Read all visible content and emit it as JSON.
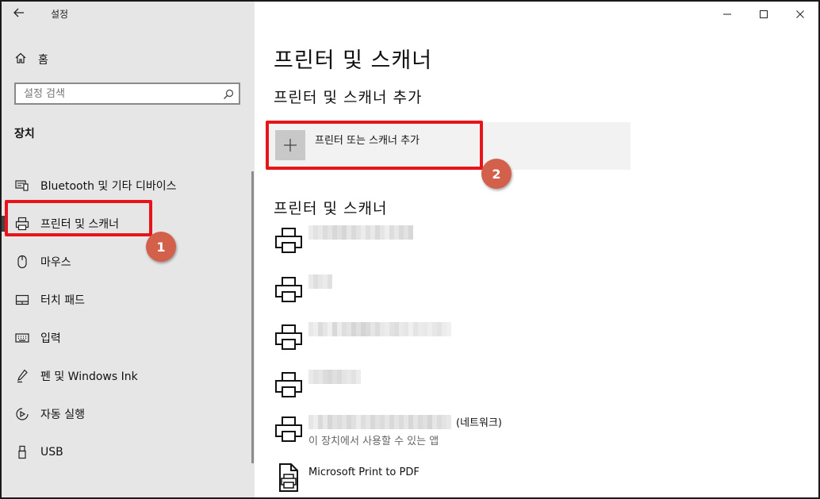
{
  "app": {
    "title": "설정",
    "back_icon": "back-arrow-icon"
  },
  "sidebar": {
    "home_label": "홈",
    "search_placeholder": "설정 검색",
    "section_label": "장치",
    "items": [
      {
        "label": "Bluetooth 및 기타 디바이스",
        "icon": "bluetooth-devices-icon",
        "active": false
      },
      {
        "label": "프린터 및 스캐너",
        "icon": "printer-icon",
        "active": true
      },
      {
        "label": "마우스",
        "icon": "mouse-icon",
        "active": false
      },
      {
        "label": "터치 패드",
        "icon": "touchpad-icon",
        "active": false
      },
      {
        "label": "입력",
        "icon": "keyboard-icon",
        "active": false
      },
      {
        "label": "펜 및 Windows Ink",
        "icon": "pen-icon",
        "active": false
      },
      {
        "label": "자동 실행",
        "icon": "autoplay-icon",
        "active": false
      },
      {
        "label": "USB",
        "icon": "usb-icon",
        "active": false
      }
    ]
  },
  "main": {
    "title": "프린터 및 스캐너",
    "add_section_title": "프린터 및 스캐너 추가",
    "add_button_label": "프린터 또는 스캐너 추가",
    "list_section_title": "프린터 및 스캐너",
    "printers": [
      {
        "name_suffix": "",
        "subtext": ""
      },
      {
        "name_suffix": "",
        "subtext": ""
      },
      {
        "name_suffix": "",
        "subtext": ""
      },
      {
        "name_suffix": "",
        "subtext": ""
      },
      {
        "name_suffix": "(네트워크)",
        "subtext": "이 장치에서 사용할 수 있는 앱"
      },
      {
        "name": "Microsoft Print to PDF",
        "subtext": ""
      }
    ]
  },
  "annotations": {
    "badge1": "1",
    "badge2": "2"
  },
  "colors": {
    "callout": "#e8141b",
    "badge": "#d2604a",
    "sidebar_bg": "#e6e6e6"
  }
}
